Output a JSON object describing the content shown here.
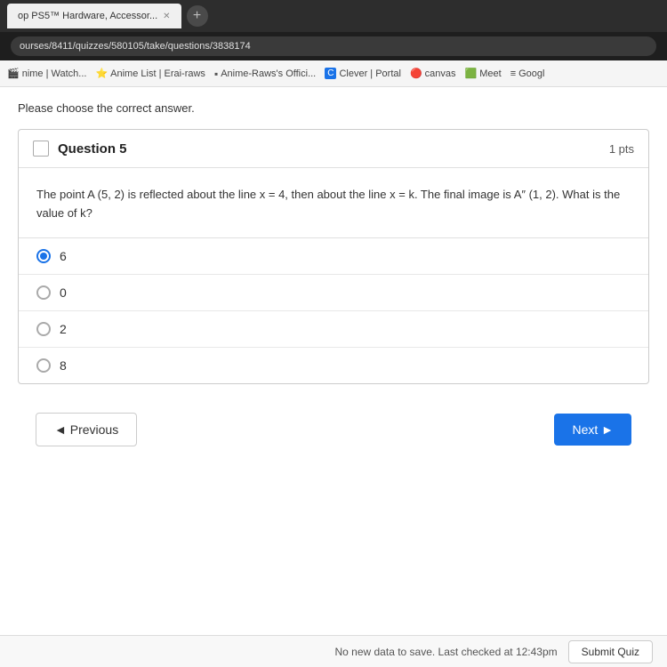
{
  "browser": {
    "tab_label": "op PS5™ Hardware, Accessor...",
    "url": "ourses/8411/quizzes/580105/take/questions/3838174",
    "new_tab_icon": "+",
    "bookmarks": [
      {
        "label": "nime | Watch...",
        "icon": "🎬"
      },
      {
        "label": "Anime List | Erai-raws",
        "icon": "⭐"
      },
      {
        "label": "Anime-Raws's Offici...",
        "icon": "🔲"
      },
      {
        "label": "Clever | Portal",
        "icon": "C"
      },
      {
        "label": "canvas",
        "icon": "🔴"
      },
      {
        "label": "Meet",
        "icon": "🟩"
      },
      {
        "label": "Googl",
        "icon": "≡"
      }
    ]
  },
  "page": {
    "instruction": "Please choose the correct answer.",
    "question": {
      "number": "Question 5",
      "points": "1 pts",
      "body": "The point A (5, 2) is reflected about the line x = 4, then about the line x = k. The final image is A″ (1, 2). What is the value of k?",
      "options": [
        {
          "label": "6",
          "selected": true
        },
        {
          "label": "0",
          "selected": false
        },
        {
          "label": "2",
          "selected": false
        },
        {
          "label": "8",
          "selected": false
        }
      ]
    },
    "nav": {
      "previous_label": "◄ Previous",
      "next_label": "Next ►"
    },
    "footer": {
      "status_text": "No new data to save. Last checked at 12:43pm",
      "submit_label": "Submit Quiz"
    }
  }
}
